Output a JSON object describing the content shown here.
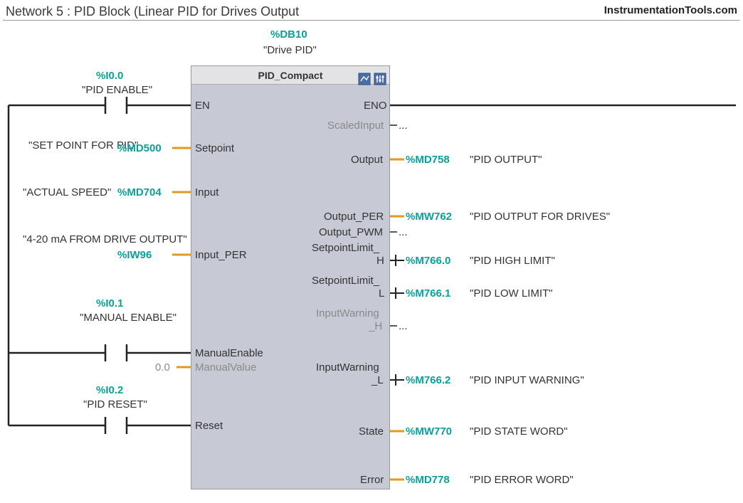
{
  "header": {
    "title": "Network 5 : PID Block (Linear PID for Drives Output",
    "brand": "InstrumentationTools.com"
  },
  "block": {
    "db_addr": "%DB10",
    "db_name": "\"Drive PID\"",
    "type": "PID_Compact",
    "icons": [
      "config-icon",
      "tune-icon"
    ]
  },
  "left_ports": {
    "en": "EN",
    "setpoint": "Setpoint",
    "input": "Input",
    "input_per": "Input_PER",
    "manual_enable": "ManualEnable",
    "manual_value": "ManualValue",
    "reset": "Reset"
  },
  "right_ports": {
    "eno": "ENO",
    "scaled_input": "ScaledInput",
    "output": "Output",
    "output_per": "Output_PER",
    "output_pwm": "Output_PWM",
    "sp_limit_h1": "SetpointLimit_",
    "sp_limit_h2": "H",
    "sp_limit_l1": "SetpointLimit_",
    "sp_limit_l2": "L",
    "in_warn_h1": "InputWarning",
    "in_warn_h2": "_H",
    "in_warn_l1": "InputWarning",
    "in_warn_l2": "_L",
    "state": "State",
    "error": "Error"
  },
  "inputs": {
    "en": {
      "addr": "%I0.0",
      "name": "\"PID ENABLE\""
    },
    "setpoint": {
      "addr": "%MD500",
      "name": "\"SET POINT FOR PID\""
    },
    "input": {
      "addr": "%MD704",
      "name": "\"ACTUAL SPEED\""
    },
    "input_per": {
      "addr": "%IW96",
      "name": "\"4-20 mA FROM DRIVE OUTPUT\""
    },
    "manual_en": {
      "addr": "%I0.1",
      "name": "\"MANUAL ENABLE\""
    },
    "manual_val": {
      "value": "0.0"
    },
    "reset": {
      "addr": "%I0.2",
      "name": "\"PID RESET\""
    }
  },
  "outputs": {
    "scaled": {
      "dots": "..."
    },
    "output": {
      "addr": "%MD758",
      "name": "\"PID OUTPUT\""
    },
    "output_per": {
      "addr": "%MW762",
      "name": "\"PID OUTPUT FOR DRIVES\""
    },
    "output_pwm": {
      "dots": "..."
    },
    "sp_h": {
      "addr": "%M766.0",
      "name": "\"PID HIGH LIMIT\""
    },
    "sp_l": {
      "addr": "%M766.1",
      "name": "\"PID LOW LIMIT\""
    },
    "inw_h": {
      "dots": "..."
    },
    "inw_l": {
      "addr": "%M766.2",
      "name": "\"PID INPUT WARNING\""
    },
    "state": {
      "addr": "%MW770",
      "name": "\"PID STATE WORD\""
    },
    "error": {
      "addr": "%MD778",
      "name": "\"PID ERROR WORD\""
    }
  }
}
